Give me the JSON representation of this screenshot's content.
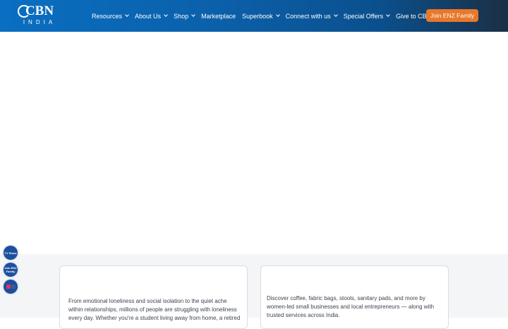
{
  "header": {
    "logo": {
      "top": "CBN",
      "bottom": "INDIA"
    },
    "nav": [
      {
        "label": "Resources",
        "dropdown": true
      },
      {
        "label": "About Us",
        "dropdown": true
      },
      {
        "label": "Shop",
        "dropdown": true
      },
      {
        "label": "Marketplace",
        "dropdown": false
      },
      {
        "label": "Superbook",
        "dropdown": true
      },
      {
        "label": "Connect with us",
        "dropdown": true
      },
      {
        "label": "Special Offers",
        "dropdown": true
      },
      {
        "label": "Give to CBN",
        "dropdown": false
      }
    ],
    "cta_label": "Join ENZ Family"
  },
  "floating": {
    "tv_show": "TV Show",
    "join_enz": "Join ENZ Family"
  },
  "cards": [
    {
      "text": "From emotional loneliness and social isolation to the quiet ache within relationships, millions of people are struggling with loneliness every day. Whether you're a student living away from home, a retired"
    },
    {
      "text": "Discover coffee, fabric bags, stools, sanitary pads, and more by women-led small businesses and local entrepreneurs — along with trusted services across India."
    }
  ],
  "colors": {
    "header_gradient_start": "#0a6fc2",
    "header_gradient_end": "#1b2f44",
    "cta": "#e8782a",
    "floating_button": "#1d4f9c"
  }
}
